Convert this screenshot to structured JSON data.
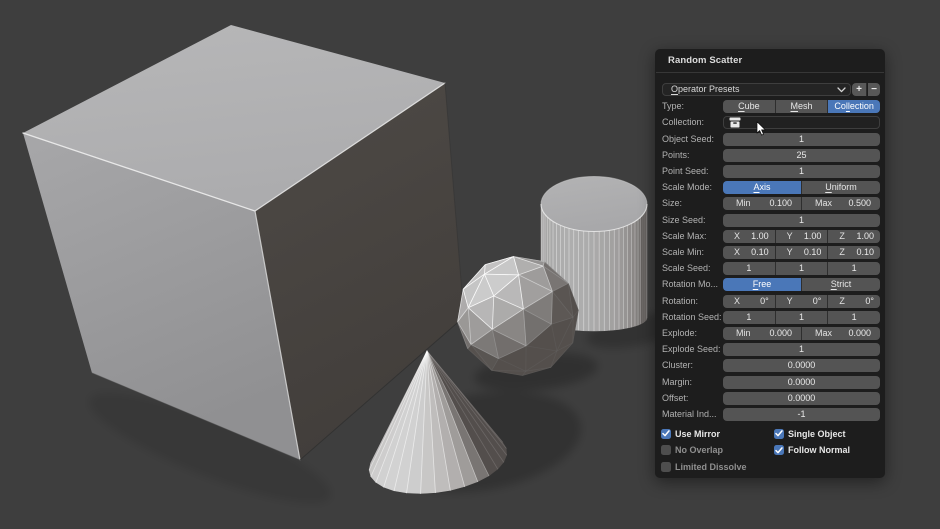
{
  "colors": {
    "viewport_background": "#3e3e3e",
    "panel_background": "#1d1d1d",
    "accent_blue": "#4a77b8",
    "field_gray": "#545454"
  },
  "viewport": {
    "objects": [
      "cube",
      "cylinder",
      "icosphere",
      "cone"
    ]
  },
  "panel": {
    "title": "Random Scatter",
    "presets": {
      "label": {
        "pre": "",
        "u": "O",
        "post": "perator Presets"
      },
      "chevron_icon": "chevron-down",
      "add_label": "+",
      "remove_label": "−"
    },
    "rows": [
      {
        "key": "type",
        "label": "Type:",
        "type": "seg",
        "selected": 2,
        "options": [
          {
            "pre": "",
            "u": "C",
            "post": "ube"
          },
          {
            "pre": "",
            "u": "M",
            "post": "esh"
          },
          {
            "pre": "Co",
            "u": "ll",
            "post": "ection"
          }
        ]
      },
      {
        "key": "collection",
        "label": "Collection:",
        "type": "collection",
        "value": "",
        "icon": "collection"
      },
      {
        "key": "object_seed",
        "label": "Object Seed:",
        "type": "value",
        "value": "1"
      },
      {
        "key": "points",
        "label": "Points:",
        "type": "value",
        "value": "25"
      },
      {
        "key": "point_seed",
        "label": "Point Seed:",
        "type": "value",
        "value": "1"
      },
      {
        "key": "scale_mode",
        "label": "Scale Mode:",
        "type": "seg",
        "selected": 0,
        "options": [
          {
            "pre": "",
            "u": "A",
            "post": "xis"
          },
          {
            "pre": "",
            "u": "U",
            "post": "niform"
          }
        ]
      },
      {
        "key": "size",
        "label": "Size:",
        "type": "minmax",
        "parts": [
          {
            "k": "Min",
            "v": "0.100"
          },
          {
            "k": "Max",
            "v": "0.500"
          }
        ]
      },
      {
        "key": "size_seed",
        "label": "Size Seed:",
        "type": "value",
        "value": "1"
      },
      {
        "key": "scale_max",
        "label": "Scale Max:",
        "type": "xyz",
        "parts": [
          {
            "k": "X",
            "v": "1.00"
          },
          {
            "k": "Y",
            "v": "1.00"
          },
          {
            "k": "Z",
            "v": "1.00"
          }
        ]
      },
      {
        "key": "scale_min",
        "label": "Scale Min:",
        "type": "xyz",
        "parts": [
          {
            "k": "X",
            "v": "0.10"
          },
          {
            "k": "Y",
            "v": "0.10"
          },
          {
            "k": "Z",
            "v": "0.10"
          }
        ]
      },
      {
        "key": "scale_seed",
        "label": "Scale Seed:",
        "type": "triple",
        "values": [
          "1",
          "1",
          "1"
        ]
      },
      {
        "key": "rotation_mode",
        "label": "Rotation Mo...",
        "type": "seg",
        "selected": 0,
        "options": [
          {
            "pre": "",
            "u": "F",
            "post": "ree"
          },
          {
            "pre": "",
            "u": "S",
            "post": "trict"
          }
        ]
      },
      {
        "key": "rotation",
        "label": "Rotation:",
        "type": "xyz",
        "parts": [
          {
            "k": "X",
            "v": "0°"
          },
          {
            "k": "Y",
            "v": "0°"
          },
          {
            "k": "Z",
            "v": "0°"
          }
        ]
      },
      {
        "key": "rotation_seed",
        "label": "Rotation Seed:",
        "type": "triple",
        "values": [
          "1",
          "1",
          "1"
        ]
      },
      {
        "key": "explode",
        "label": "Explode:",
        "type": "minmax",
        "parts": [
          {
            "k": "Min",
            "v": "0.000"
          },
          {
            "k": "Max",
            "v": "0.000"
          }
        ]
      },
      {
        "key": "explode_seed",
        "label": "Explode Seed:",
        "type": "value",
        "value": "1"
      },
      {
        "key": "cluster",
        "label": "Cluster:",
        "type": "value",
        "value": "0.0000"
      },
      {
        "key": "margin",
        "label": "Margin:",
        "type": "value",
        "value": "0.0000"
      },
      {
        "key": "offset",
        "label": "Offset:",
        "type": "value",
        "value": "0.0000"
      },
      {
        "key": "material_index",
        "label": "Material Ind...",
        "type": "value",
        "value": "-1"
      }
    ],
    "checkboxes": [
      {
        "key": "use_mirror",
        "label": "Use Mirror",
        "checked": true
      },
      {
        "key": "single_object",
        "label": "Single Object",
        "checked": true
      },
      {
        "key": "no_overlap",
        "label": "No Overlap",
        "checked": false
      },
      {
        "key": "follow_normal",
        "label": "Follow Normal",
        "checked": true
      },
      {
        "key": "limited_dissolve",
        "label": "Limited Dissolve",
        "checked": false
      }
    ]
  }
}
